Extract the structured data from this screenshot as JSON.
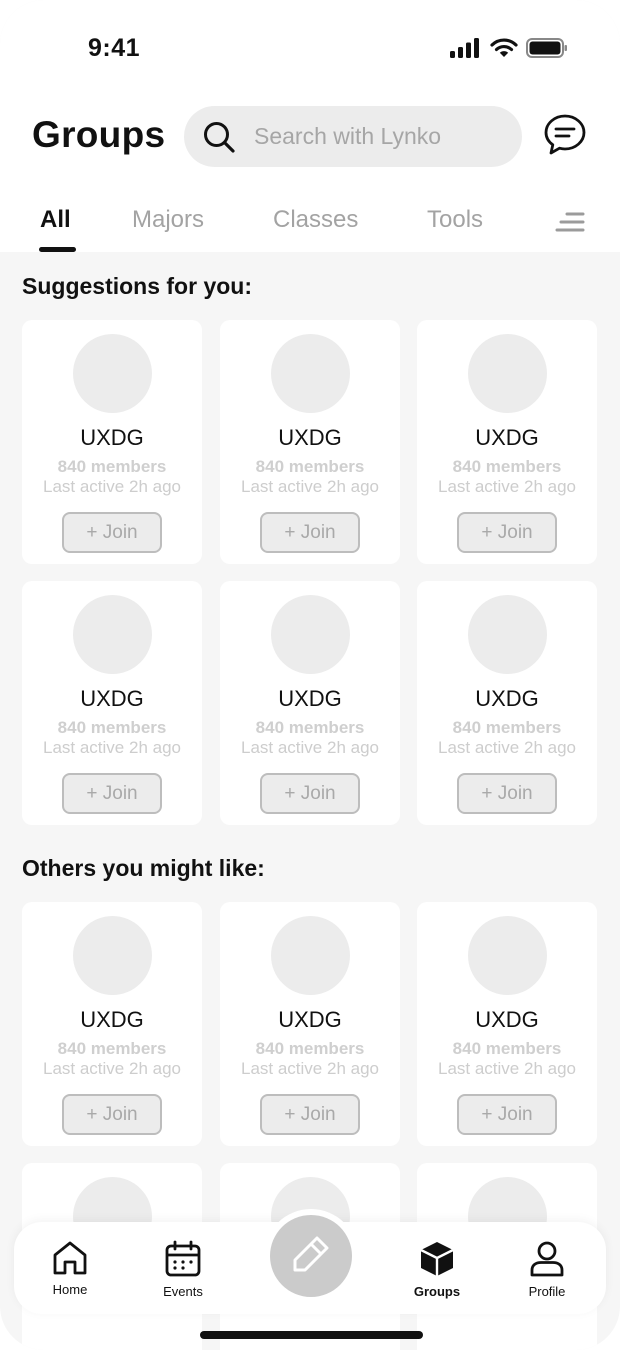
{
  "status_bar": {
    "time": "9:41"
  },
  "header": {
    "title": "Groups",
    "search_placeholder": "Search with Lynko"
  },
  "tabs": [
    {
      "label": "All",
      "active": true
    },
    {
      "label": "Majors",
      "active": false
    },
    {
      "label": "Classes",
      "active": false
    },
    {
      "label": "Tools",
      "active": false
    }
  ],
  "sections": {
    "suggestions_title": "Suggestions for you:",
    "others_title": "Others you might like:"
  },
  "group_card": {
    "name": "UXDG",
    "members": "840 members",
    "last_active": "Last active 2h ago",
    "join_label": "+ Join"
  },
  "bottom_nav": [
    {
      "label": "Home",
      "icon": "home-icon",
      "active": false
    },
    {
      "label": "Events",
      "icon": "calendar-icon",
      "active": false
    },
    {
      "label": "Groups",
      "icon": "cube-icon",
      "active": true
    },
    {
      "label": "Profile",
      "icon": "person-icon",
      "active": false
    }
  ],
  "fab_icon": "pencil-icon",
  "colors": {
    "background": "#f6f6f6",
    "surface": "#ffffff",
    "placeholder": "#ececec",
    "muted_text": "#a3a3a3",
    "primary_text": "#111111",
    "fab": "#cbcbcb"
  }
}
